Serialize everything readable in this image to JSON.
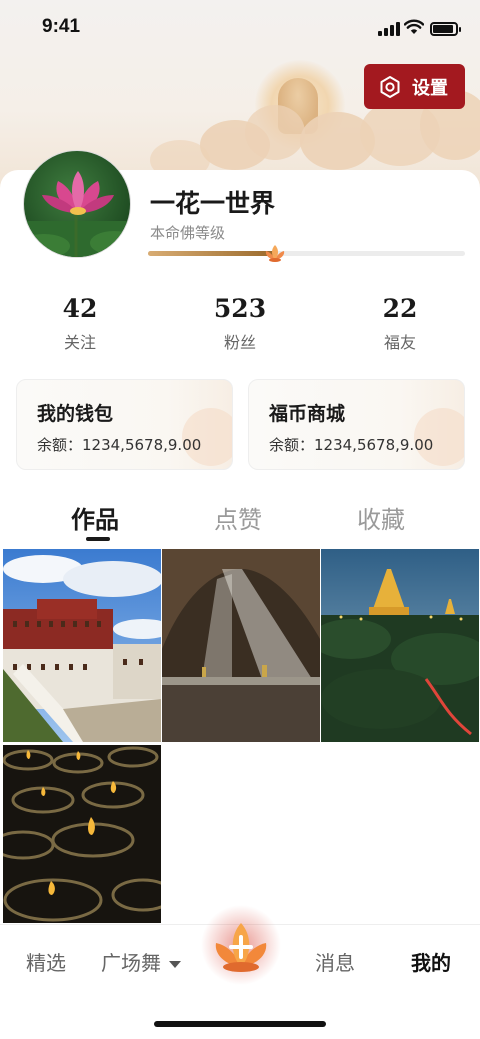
{
  "status_bar": {
    "time": "9:41"
  },
  "header": {
    "settings_label": "设置"
  },
  "profile": {
    "name": "一花一世界",
    "level_label": "本命佛等级",
    "level_progress": 0.4
  },
  "stats": [
    {
      "value": "42",
      "label": "关注"
    },
    {
      "value": "523",
      "label": "粉丝"
    },
    {
      "value": "22",
      "label": "福友"
    }
  ],
  "cards": [
    {
      "title": "我的钱包",
      "balance": "余额：1234,5678,9.00"
    },
    {
      "title": "福币商城",
      "balance": "余额：1234,5678,9.00"
    }
  ],
  "tabs": [
    {
      "label": "作品",
      "active": true
    },
    {
      "label": "点赞",
      "active": false
    },
    {
      "label": "收藏",
      "active": false
    }
  ],
  "photos": [
    "potala-palace-photo",
    "cave-light-photo",
    "golden-pagoda-photo",
    "butter-lamps-photo"
  ],
  "bottom_nav": {
    "items": [
      {
        "label": "精选"
      },
      {
        "label": "广场舞"
      },
      {
        "label": "消息"
      },
      {
        "label": "我的"
      }
    ],
    "active": "我的"
  },
  "colors": {
    "accent": "#a3191f",
    "progress": "#c08a47"
  }
}
